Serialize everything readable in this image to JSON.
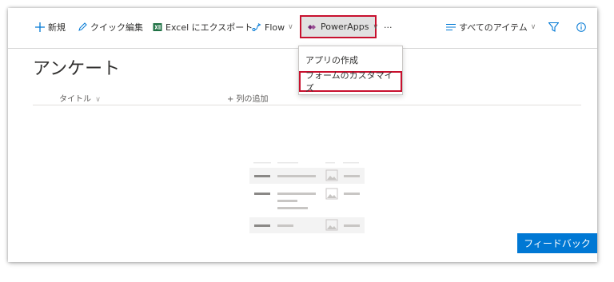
{
  "toolbar": {
    "new_label": "新規",
    "quick_edit_label": "クイック編集",
    "export_excel_label": "Excel にエクスポート",
    "flow_label": "Flow",
    "powerapps_label": "PowerApps",
    "more_label": "···",
    "view_label": "すべてのアイテム"
  },
  "page": {
    "title": "アンケート"
  },
  "list": {
    "columns": [
      {
        "label": "タイトル"
      }
    ],
    "add_column_label": "+ 列の追加"
  },
  "powerapps_menu": {
    "items": [
      {
        "label": "アプリの作成"
      },
      {
        "label": "フォームのカスタマイズ"
      }
    ]
  },
  "feedback_button": "フィードバック",
  "colors": {
    "accent": "#0078d4",
    "highlight_border": "#c8102e",
    "selected_bg": "#e1e1e1",
    "excel_green": "#217346"
  },
  "icons": {
    "new": "plus-icon",
    "quick_edit": "pencil-icon",
    "export_excel": "excel-icon",
    "flow": "flow-icon",
    "powerapps": "powerapps-icon",
    "view": "view-lines-icon",
    "filter": "filter-icon",
    "info": "info-icon"
  }
}
